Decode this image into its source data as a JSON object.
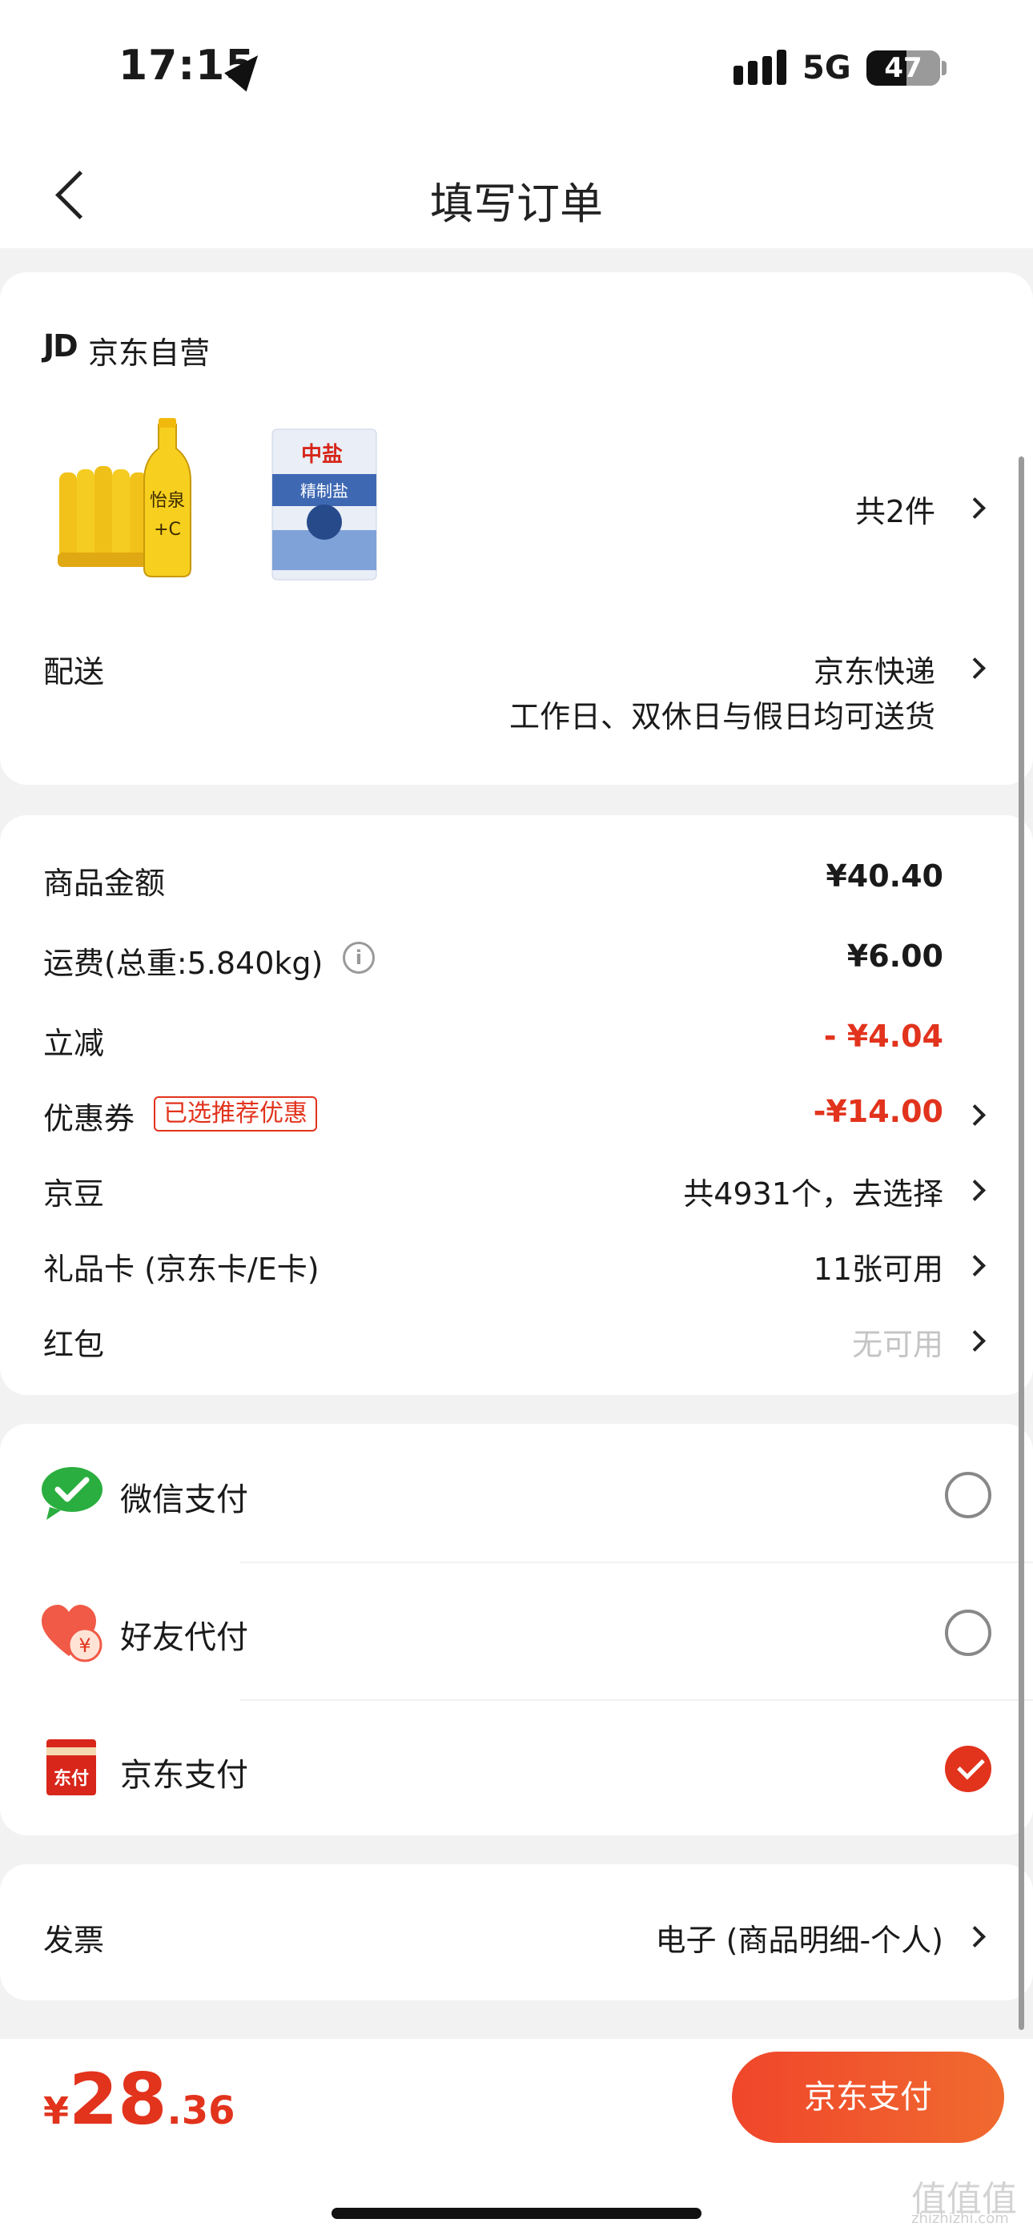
{
  "status_bar": {
    "time": "17:15",
    "network": "5G",
    "battery": "47"
  },
  "nav": {
    "title": "填写订单"
  },
  "shop": {
    "logo": "JD",
    "name": "京东自营",
    "item_count": "共2件"
  },
  "delivery": {
    "label": "配送",
    "carrier": "京东快递",
    "note": "工作日、双休日与假日均可送货"
  },
  "fees": {
    "goods_label": "商品金额",
    "goods_value": "¥40.40",
    "shipping_label": "运费(总重:5.840kg)",
    "shipping_value": "¥6.00",
    "discount_label": "立减",
    "discount_value": "- ¥4.04",
    "coupon_label": "优惠券",
    "coupon_badge": "已选推荐优惠",
    "coupon_value": "-¥14.00",
    "jingdou_label": "京豆",
    "jingdou_value": "共4931个，去选择",
    "giftcard_label": "礼品卡 (京东卡/E卡)",
    "giftcard_value": "11张可用",
    "redpacket_label": "红包",
    "redpacket_value": "无可用"
  },
  "payment": {
    "options": [
      {
        "name": "微信支付",
        "selected": false
      },
      {
        "name": "好友代付",
        "selected": false
      },
      {
        "name": "京东支付",
        "selected": true
      }
    ],
    "jd_icon_text": "东付",
    "friend_icon_text": "¥"
  },
  "invoice": {
    "label": "发票",
    "value": "电子 (商品明细-个人)"
  },
  "products": [
    {
      "name": "怡泉",
      "sub": "+C"
    },
    {
      "name": "精制盐",
      "sub": "中盐"
    }
  ],
  "footer": {
    "currency": "¥",
    "price_int": "28",
    "price_dec": ".36",
    "pay_button": "京东支付"
  },
  "watermark": {
    "text": "值值值",
    "sub": "zhizhizhi.com"
  },
  "colors": {
    "accent": "#e2331d",
    "wechat": "#2aae3f"
  }
}
